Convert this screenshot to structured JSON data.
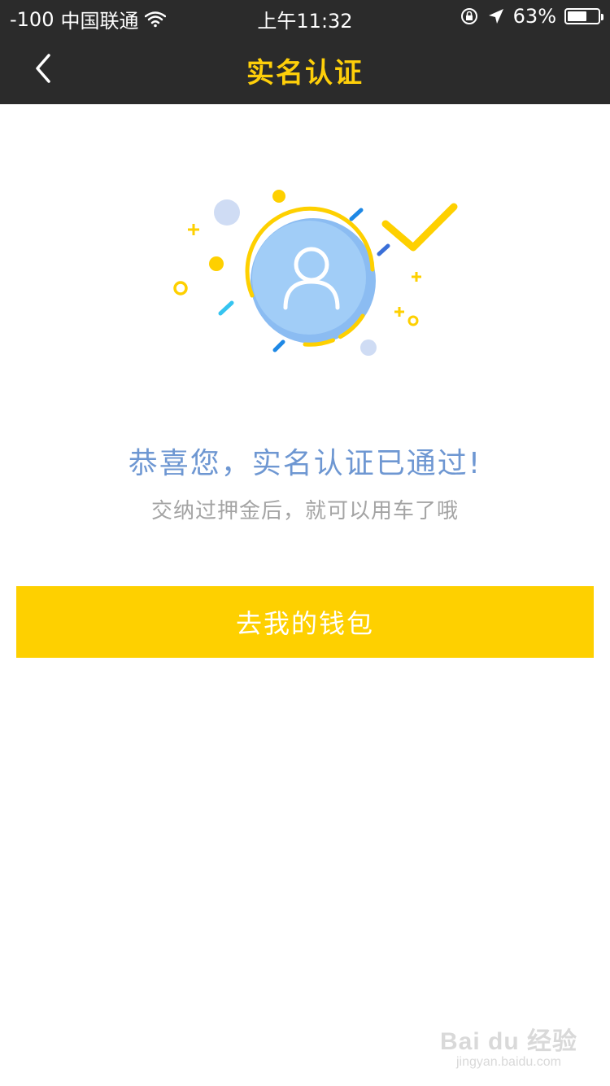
{
  "status_bar": {
    "signal": "-100",
    "carrier": "中国联通",
    "time": "上午11:32",
    "battery_percent": "63%",
    "battery_level": 0.63
  },
  "nav": {
    "title": "实名认证"
  },
  "main": {
    "success_title": "恭喜您，实名认证已通过!",
    "success_subtitle": "交纳过押金后，就可以用车了哦",
    "wallet_button_label": "去我的钱包"
  },
  "watermark": {
    "logo": "Bai du 经验",
    "url": "jingyan.baidu.com"
  },
  "colors": {
    "bar_background": "#2b2b2b",
    "accent_yellow": "#fed000",
    "title_blue": "#6e97d2",
    "subtitle_gray": "#a4a4a4"
  }
}
